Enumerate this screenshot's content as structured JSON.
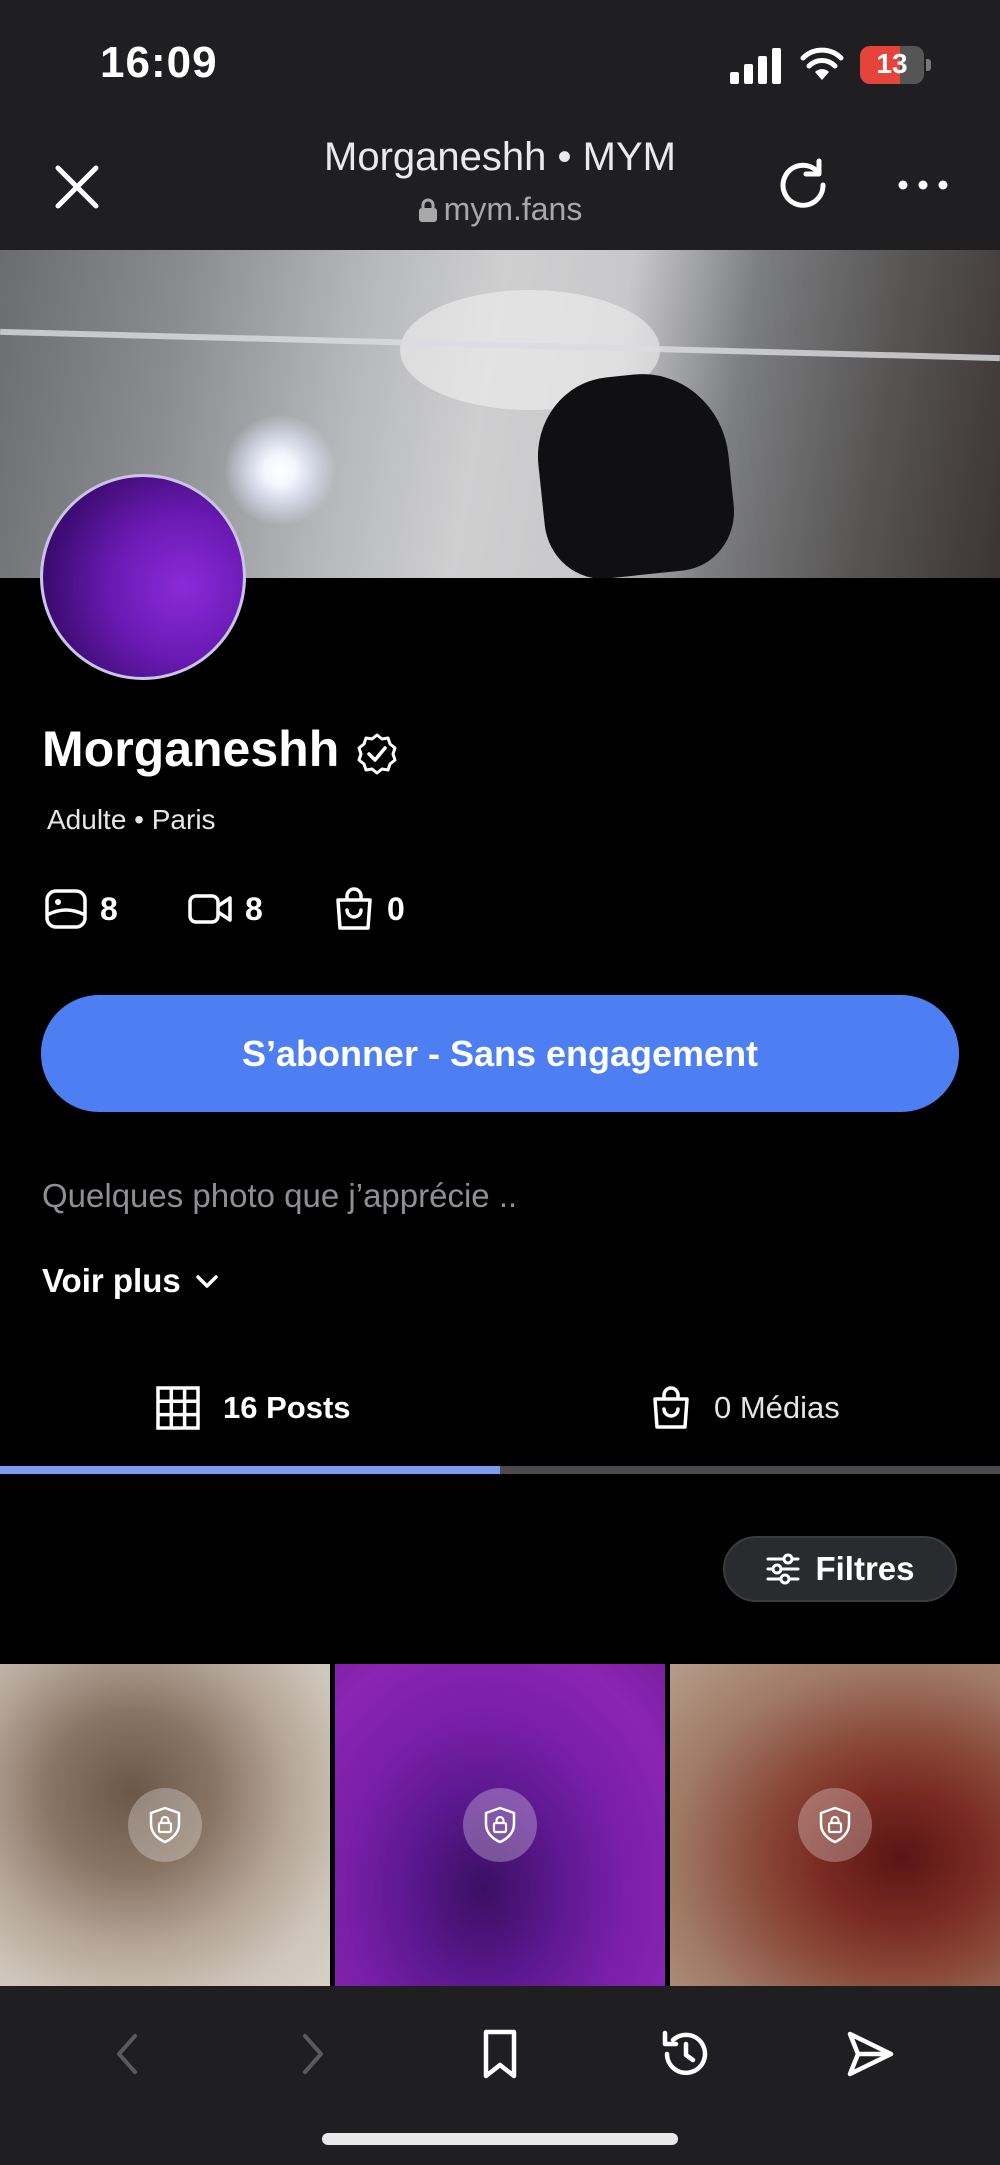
{
  "status_bar": {
    "time": "16:09",
    "battery": "13",
    "battery_color": "#e5443b"
  },
  "browser": {
    "title": "Morganeshh • MYM",
    "url": "mym.fans",
    "icons": {
      "close": "close-icon",
      "lock": "lock-icon",
      "reload": "reload-icon",
      "more": "more-icon"
    }
  },
  "profile": {
    "name": "Morganeshh",
    "verified": true,
    "meta": "Adulte • Paris",
    "stats": {
      "photos": "8",
      "videos": "8",
      "shop": "0"
    },
    "subscribe_label": "S’abonner - Sans engagement",
    "bio": "Quelques photo que j’apprécie ..",
    "see_more_label": "Voir plus"
  },
  "tabs": {
    "posts_label": "16 Posts",
    "media_label": "0 Médias",
    "active": "posts"
  },
  "filters_label": "Filtres",
  "grid": {
    "items": [
      {
        "locked": true
      },
      {
        "locked": true
      },
      {
        "locked": true
      }
    ]
  },
  "colors": {
    "accent": "#4d7ff2",
    "tab_indicator": "#7e9df2",
    "background": "#000000",
    "chrome": "#1f1f21"
  }
}
